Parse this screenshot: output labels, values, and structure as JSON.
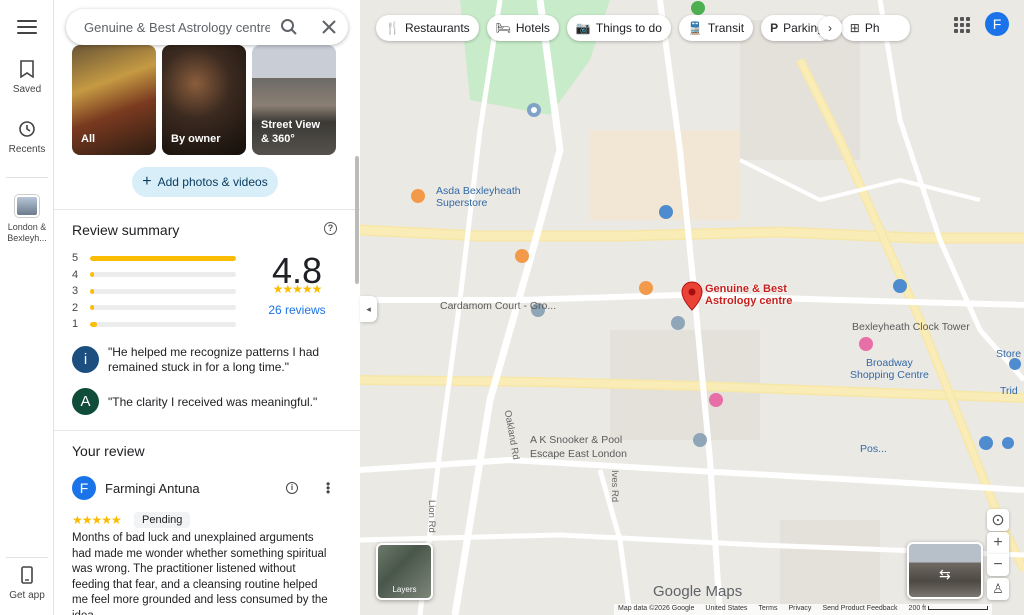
{
  "rail": {
    "saved": "Saved",
    "recents": "Recents",
    "recent_place": "London & Bexleyh...",
    "get_app": "Get app"
  },
  "search": {
    "value": "Genuine & Best Astrology centre"
  },
  "chips": [
    {
      "label": "Restaurants",
      "icon": "restaurant-icon"
    },
    {
      "label": "Hotels",
      "icon": "hotel-icon"
    },
    {
      "label": "Things to do",
      "icon": "camera-icon"
    },
    {
      "label": "Transit",
      "icon": "transit-icon"
    },
    {
      "label": "Parking",
      "icon": "parking-icon"
    },
    {
      "label": "Ph",
      "icon": "pharmacy-icon"
    }
  ],
  "account_initial": "F",
  "photos": [
    {
      "label": "All"
    },
    {
      "label": "By owner"
    },
    {
      "label": "Street View & 360°"
    }
  ],
  "add_photos": "Add photos & videos",
  "review_summary": {
    "title": "Review summary",
    "rating": "4.8",
    "stars": 4.8,
    "reviews_link": "26 reviews",
    "distribution": [
      {
        "stars": "5",
        "fraction": 1.0
      },
      {
        "stars": "4",
        "fraction": 0.01
      },
      {
        "stars": "3",
        "fraction": 0.01
      },
      {
        "stars": "2",
        "fraction": 0.01
      },
      {
        "stars": "1",
        "fraction": 0.05
      }
    ]
  },
  "quotes": [
    {
      "avatar": "i",
      "text": "\"He helped me recognize patterns I had remained stuck in for a long time.\""
    },
    {
      "avatar": "A",
      "text": "\"The clarity I received was meaningful.\""
    }
  ],
  "your_review": {
    "title": "Your review",
    "user_initial": "F",
    "user_name": "Farmingi Antuna",
    "stars": 5,
    "status": "Pending",
    "text": "Months of bad luck and unexplained arguments had made me wonder whether something spiritual was wrong. The practitioner listened without feeding that fear, and a cleansing routine helped me feel more grounded and less consumed by the idea."
  },
  "map": {
    "pin_label": "Genuine & Best Astrology centre",
    "labels": {
      "asda": "Asda Bexleyheath\nSuperstore",
      "cardamom": "Cardamom Court - Gro...",
      "broadway": "Broadway\nShopping Centre",
      "bexleyheath": "Bexleyheath Clock Tower",
      "snooker": "A K Snooker & Pool",
      "escape": "Escape East London",
      "post": "Pos...",
      "store": "Store",
      "trid": "Trid",
      "oakland": "Oakland Rd",
      "lion": "Lion Rd",
      "ives": "Ives Rd"
    },
    "layers": "Layers",
    "google_logo": "Google Maps",
    "footer": [
      "Map data ©2026 Google",
      "United States",
      "Terms",
      "Privacy",
      "Send Product Feedback",
      "200 ft"
    ]
  },
  "colors": {
    "accent": "#1a73e8",
    "star": "#fbbc04",
    "pin": "#ea4335",
    "chip_bg": "#ffffff"
  }
}
